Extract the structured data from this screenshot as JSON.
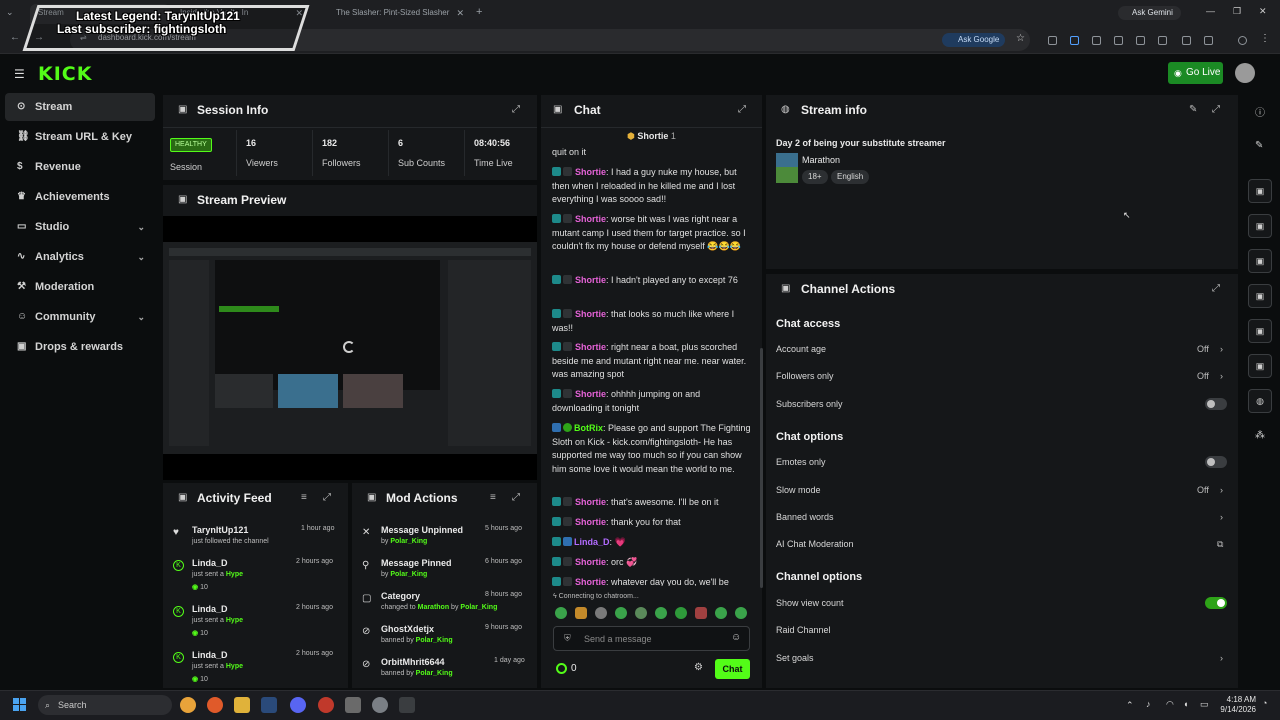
{
  "browser": {
    "tabs": [
      {
        "label": "Stream"
      },
      {
        "label": "Inside the Vault - In"
      },
      {
        "label": "The Slasher: Pint-Sized Slasher"
      }
    ],
    "new_tab": "+",
    "url": "dashboard.kick.com/stream",
    "ask_google": "Ask Google",
    "ask_gemini": "Ask Gemini"
  },
  "overlay": {
    "line1": "Latest Legend: TarynItUp121",
    "line2": "Last subscriber: fightingsloth"
  },
  "header": {
    "logo": "KICK",
    "go_live": "Go Live"
  },
  "sidebar": {
    "items": [
      {
        "label": "Stream",
        "icon": "⊙"
      },
      {
        "label": "Stream URL & Key",
        "icon": "⛓"
      },
      {
        "label": "Revenue",
        "icon": "$"
      },
      {
        "label": "Achievements",
        "icon": "♛"
      },
      {
        "label": "Studio",
        "icon": "▭"
      },
      {
        "label": "Analytics",
        "icon": "∿"
      },
      {
        "label": "Moderation",
        "icon": "⚒"
      },
      {
        "label": "Community",
        "icon": "☺"
      },
      {
        "label": "Drops & rewards",
        "icon": "▣"
      }
    ]
  },
  "session_info": {
    "title": "Session Info",
    "status": "HEALTHY",
    "status_label": "Session",
    "stats": [
      {
        "value": "16",
        "label": "Viewers"
      },
      {
        "value": "182",
        "label": "Followers"
      },
      {
        "value": "6",
        "label": "Sub Counts"
      },
      {
        "value": "08:40:56",
        "label": "Time Live"
      }
    ]
  },
  "stream_preview": {
    "title": "Stream Preview"
  },
  "activity_feed": {
    "title": "Activity Feed",
    "items": [
      {
        "name": "TarynItUp121",
        "action": "just followed the channel",
        "time": "1 hour ago",
        "amount": ""
      },
      {
        "name": "Linda_D",
        "action": "just sent a",
        "highlight": "Hype",
        "time": "2 hours ago",
        "amount": "10"
      },
      {
        "name": "Linda_D",
        "action": "just sent a",
        "highlight": "Hype",
        "time": "2 hours ago",
        "amount": "10"
      },
      {
        "name": "Linda_D",
        "action": "just sent a",
        "highlight": "Hype",
        "time": "2 hours ago",
        "amount": "10"
      }
    ]
  },
  "mod_actions": {
    "title": "Mod Actions",
    "items": [
      {
        "title": "Message Unpinned",
        "prefix": "by",
        "detail": "",
        "by": "Polar_King",
        "time": "5 hours ago"
      },
      {
        "title": "Message Pinned",
        "prefix": "by",
        "detail": "",
        "by": "Polar_King",
        "time": "6 hours ago"
      },
      {
        "title": "Category",
        "prefix": "changed to",
        "detail": "Marathon",
        "by": "Polar_King",
        "time": "8 hours ago"
      },
      {
        "title": "GhostXdetjx",
        "prefix": "banned by",
        "detail": "",
        "by": "Polar_King",
        "time": "9 hours ago"
      },
      {
        "title": "OrbitMhrit6644",
        "prefix": "banned by",
        "detail": "",
        "by": "Polar_King",
        "time": "1 day ago"
      }
    ]
  },
  "chat": {
    "title": "Chat",
    "pinned_user": "Shortie",
    "pinned_count": "1",
    "top_fragment": "quit on it",
    "messages": [
      {
        "user": "Shortie",
        "text": "I had a guy nuke my house, but then when I reloaded in he killed me and I lost everything I was soooo sad!!",
        "color": "#e462d6"
      },
      {
        "user": "Shortie",
        "text": "worse bit was I was right near a mutant camp I used them for target practice. so I couldn't fix my house or defend myself 😂😂😂",
        "color": "#e462d6"
      },
      {
        "user": "Shortie",
        "text": "I hadn't played any to except 76",
        "color": "#e462d6"
      },
      {
        "user": "Shortie",
        "text": "that looks so much like where I was!!",
        "color": "#e462d6"
      },
      {
        "user": "Shortie",
        "text": "right near a boat, plus scorched beside me and mutant right near me. near water. was amazing spot",
        "color": "#e462d6"
      },
      {
        "user": "Shortie",
        "text": "ohhhh jumping on and downloading it tonight",
        "color": "#e462d6"
      },
      {
        "user": "BotRix",
        "text": "Please go and support The Fighting Sloth on Kick - kick.com/fightingsloth- He has supported me way too much so if you can show him some love it would mean the world to me.",
        "color": "#53fc18"
      },
      {
        "user": "Shortie",
        "text": "that's awesome. I'll be on it",
        "color": "#e462d6"
      },
      {
        "user": "Shortie",
        "text": "thank you for that",
        "color": "#e462d6"
      },
      {
        "user": "Linda_D",
        "text": "💗",
        "color": "#b26bff"
      },
      {
        "user": "Shortie",
        "text": "orc 💞",
        "color": "#e462d6"
      },
      {
        "user": "Shortie",
        "text": "whatever day you do, we'll be",
        "color": "#e462d6"
      }
    ],
    "connecting": "Connecting to chatroom...",
    "input_placeholder": "Send a message",
    "points": "0",
    "send_label": "Chat"
  },
  "stream_info": {
    "title": "Stream info",
    "stream_title": "Day 2 of being your substitute streamer",
    "category": "Marathon",
    "tags": [
      "18+",
      "English"
    ]
  },
  "channel_actions": {
    "title": "Channel Actions",
    "chat_access_heading": "Chat access",
    "chat_options_heading": "Chat options",
    "channel_options_heading": "Channel options",
    "rows": {
      "account_age": {
        "label": "Account age",
        "value": "Off"
      },
      "followers_only": {
        "label": "Followers only",
        "value": "Off"
      },
      "subscribers_only": {
        "label": "Subscribers only"
      },
      "emotes_only": {
        "label": "Emotes only"
      },
      "slow_mode": {
        "label": "Slow mode",
        "value": "Off"
      },
      "banned_words": {
        "label": "Banned words"
      },
      "ai_moderation": {
        "label": "AI Chat Moderation"
      },
      "show_view_count": {
        "label": "Show view count"
      },
      "raid_channel": {
        "label": "Raid Channel"
      },
      "set_goals": {
        "label": "Set goals"
      }
    }
  },
  "taskbar": {
    "search": "Search",
    "time": "4:18 AM",
    "date": "9/14/2026"
  },
  "colors": {
    "kick_green": "#53fc18",
    "panel_bg": "#151719",
    "page_bg": "#0b0d0e"
  }
}
